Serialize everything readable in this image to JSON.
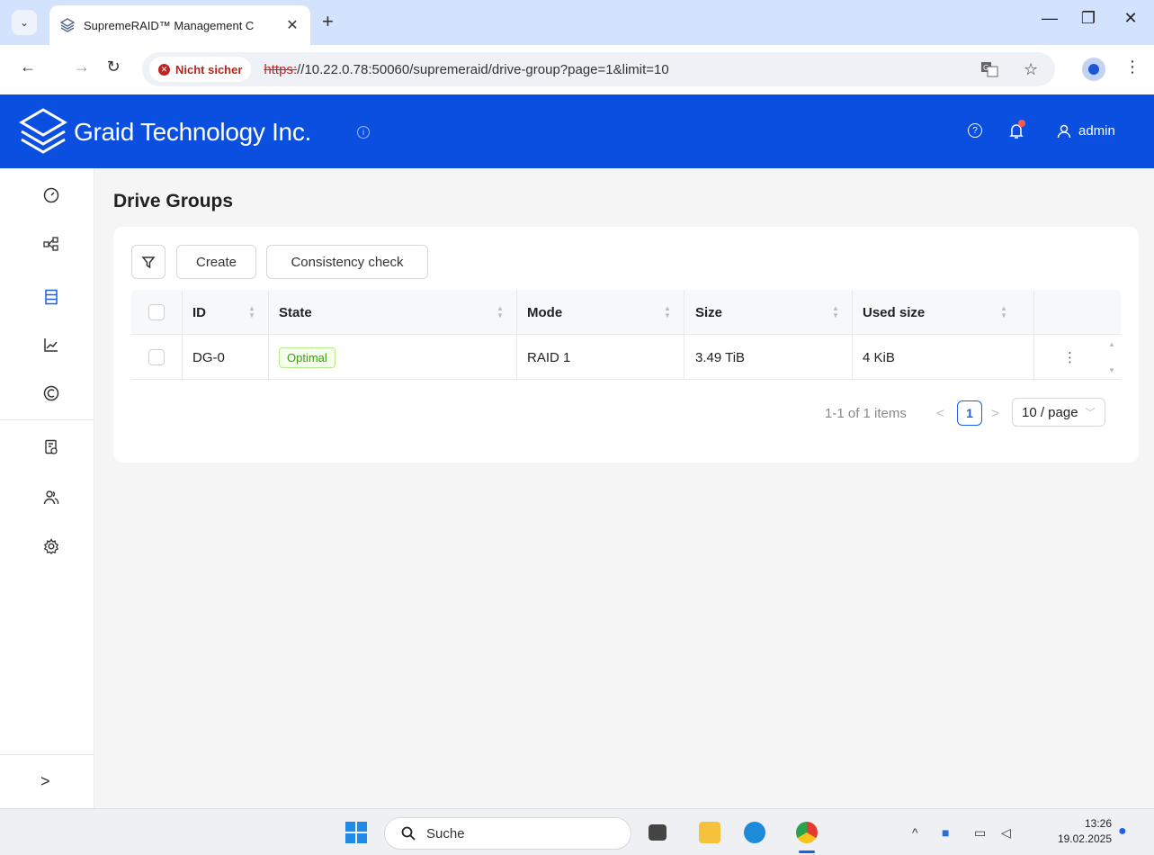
{
  "browser": {
    "tab_title": "SupremeRAID™ Management C",
    "security_label": "Nicht sicher",
    "url_scheme": "https:",
    "url_rest": "//10.22.0.78:50060/supremeraid/drive-group?page=1&limit=10"
  },
  "header": {
    "brand": "Graid Technology Inc.",
    "user": "admin"
  },
  "page": {
    "title": "Drive Groups"
  },
  "toolbar": {
    "create_label": "Create",
    "consistency_label": "Consistency check"
  },
  "table": {
    "columns": [
      "ID",
      "State",
      "Mode",
      "Size",
      "Used size"
    ],
    "rows": [
      {
        "id": "DG-0",
        "state": "Optimal",
        "mode": "RAID 1",
        "size": "3.49 TiB",
        "used_size": "4 KiB"
      }
    ]
  },
  "pagination": {
    "summary": "1-1 of 1 items",
    "current_page": "1",
    "page_size": "10 / page"
  },
  "taskbar": {
    "search_label": "Suche",
    "time": "13:26",
    "date": "19.02.2025"
  },
  "colors": {
    "brand_blue": "#0a4fe0",
    "active_blue": "#1d5fe8",
    "optimal_green": "#389e0d"
  }
}
